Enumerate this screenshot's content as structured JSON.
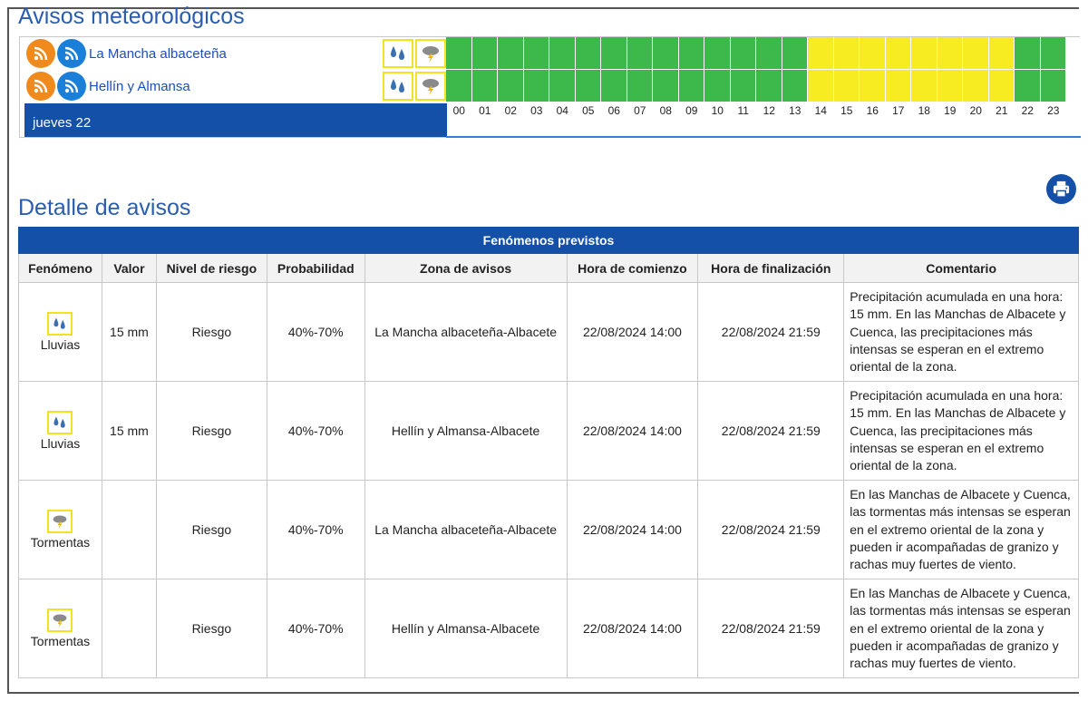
{
  "titles": {
    "avisos": "Avisos meteorológicos",
    "detalle": "Detalle de avisos"
  },
  "timeline": {
    "day_label": "jueves 22",
    "zones": [
      {
        "name": "La Mancha albaceteña",
        "icons": [
          "rain-icon",
          "storm-icon"
        ]
      },
      {
        "name": "Hellín y Almansa",
        "icons": [
          "rain-icon",
          "storm-icon"
        ]
      }
    ],
    "hours": [
      "00",
      "01",
      "02",
      "03",
      "04",
      "05",
      "06",
      "07",
      "08",
      "09",
      "10",
      "11",
      "12",
      "13",
      "14",
      "15",
      "16",
      "17",
      "18",
      "19",
      "20",
      "21",
      "22",
      "23"
    ],
    "levels": [
      [
        "green",
        "green",
        "green",
        "green",
        "green",
        "green",
        "green",
        "green",
        "green",
        "green",
        "green",
        "green",
        "green",
        "green",
        "yellow",
        "yellow",
        "yellow",
        "yellow",
        "yellow",
        "yellow",
        "yellow",
        "yellow",
        "green",
        "green"
      ],
      [
        "green",
        "green",
        "green",
        "green",
        "green",
        "green",
        "green",
        "green",
        "green",
        "green",
        "green",
        "green",
        "green",
        "green",
        "yellow",
        "yellow",
        "yellow",
        "yellow",
        "yellow",
        "yellow",
        "yellow",
        "yellow",
        "green",
        "green"
      ]
    ],
    "colors": {
      "green": "#3db84a",
      "yellow": "#f7ec22",
      "dayBar": "#1550a8"
    }
  },
  "table": {
    "caption": "Fenómenos previstos",
    "headers": [
      "Fenómeno",
      "Valor",
      "Nivel de riesgo",
      "Probabilidad",
      "Zona de avisos",
      "Hora de comienzo",
      "Hora de finalización",
      "Comentario"
    ],
    "rows": [
      {
        "icon": "rain-icon",
        "phenomenon": "Lluvias",
        "value": "15 mm",
        "risk": "Riesgo",
        "probability": "40%-70%",
        "zone": "La Mancha albaceteña-Albacete",
        "start": "22/08/2024 14:00",
        "end": "22/08/2024 21:59",
        "comment": "Precipitación acumulada en una hora: 15 mm. En las Manchas de Albacete y Cuenca, las precipitaciones más intensas se esperan en el extremo oriental de la zona."
      },
      {
        "icon": "rain-icon",
        "phenomenon": "Lluvias",
        "value": "15 mm",
        "risk": "Riesgo",
        "probability": "40%-70%",
        "zone": "Hellín y Almansa-Albacete",
        "start": "22/08/2024 14:00",
        "end": "22/08/2024 21:59",
        "comment": "Precipitación acumulada en una hora: 15 mm. En las Manchas de Albacete y Cuenca, las precipitaciones más intensas se esperan en el extremo oriental de la zona."
      },
      {
        "icon": "storm-icon",
        "phenomenon": "Tormentas",
        "value": "",
        "risk": "Riesgo",
        "probability": "40%-70%",
        "zone": "La Mancha albaceteña-Albacete",
        "start": "22/08/2024 14:00",
        "end": "22/08/2024 21:59",
        "comment": "En las Manchas de Albacete y Cuenca, las tormentas más intensas se esperan en el extremo oriental de la zona y pueden ir acompañadas de granizo y rachas muy fuertes de viento."
      },
      {
        "icon": "storm-icon",
        "phenomenon": "Tormentas",
        "value": "",
        "risk": "Riesgo",
        "probability": "40%-70%",
        "zone": "Hellín y Almansa-Albacete",
        "start": "22/08/2024 14:00",
        "end": "22/08/2024 21:59",
        "comment": "En las Manchas de Albacete y Cuenca, las tormentas más intensas se esperan en el extremo oriental de la zona y pueden ir acompañadas de granizo y rachas muy fuertes de viento."
      }
    ]
  }
}
